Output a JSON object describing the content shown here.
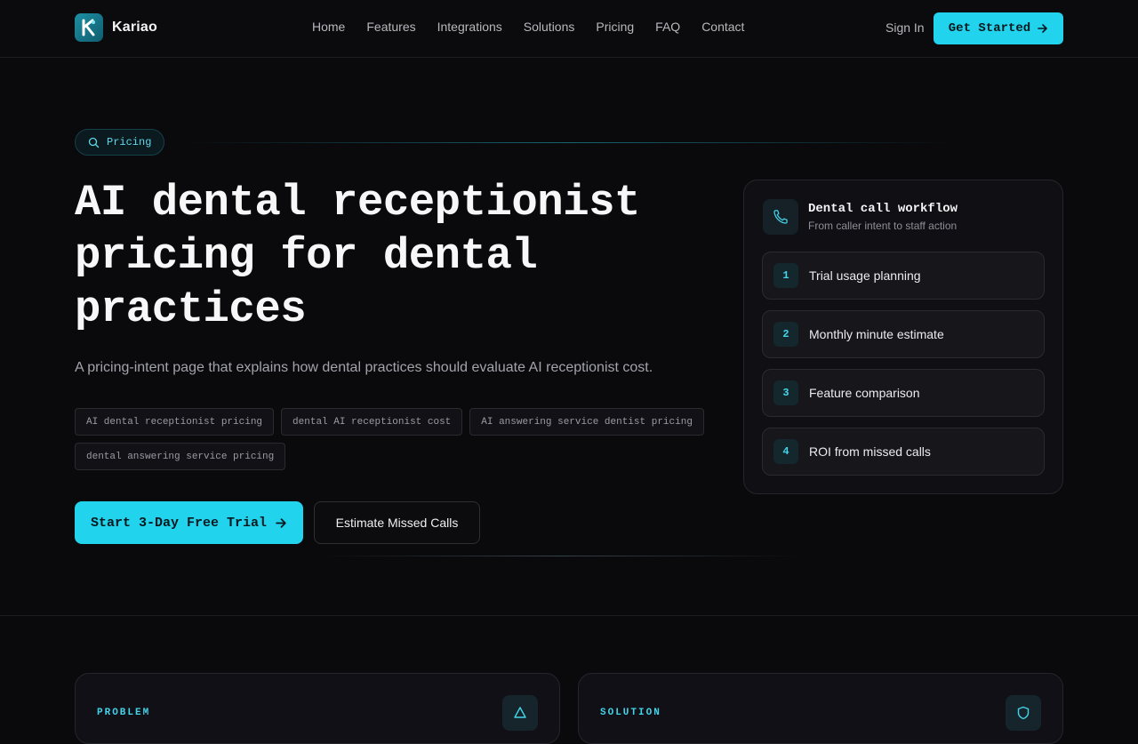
{
  "brand": {
    "name": "Kariao",
    "logo_letter": "K"
  },
  "nav": {
    "links": [
      "Home",
      "Features",
      "Integrations",
      "Solutions",
      "Pricing",
      "FAQ",
      "Contact"
    ],
    "sign_in": "Sign In",
    "get_started": "Get Started"
  },
  "hero": {
    "pill": "Pricing",
    "title": "AI dental receptionist pricing for dental practices",
    "subtitle": "A pricing-intent page that explains how dental practices should evaluate AI receptionist cost.",
    "tags": [
      "AI dental receptionist pricing",
      "dental AI receptionist cost",
      "AI answering service dentist pricing",
      "dental answering service pricing"
    ],
    "cta_primary": "Start 3-Day Free Trial",
    "cta_secondary": "Estimate Missed Calls"
  },
  "workflow": {
    "title": "Dental call workflow",
    "subtitle": "From caller intent to staff action",
    "steps": [
      {
        "num": "1",
        "label": "Trial usage planning"
      },
      {
        "num": "2",
        "label": "Monthly minute estimate"
      },
      {
        "num": "3",
        "label": "Feature comparison"
      },
      {
        "num": "4",
        "label": "ROI from missed calls"
      }
    ]
  },
  "lower_cards": [
    {
      "label": "PROBLEM",
      "icon": "alert-icon"
    },
    {
      "label": "SOLUTION",
      "icon": "shield-icon"
    }
  ],
  "colors": {
    "accent": "#22d3ee",
    "background": "#0a0a0d"
  }
}
